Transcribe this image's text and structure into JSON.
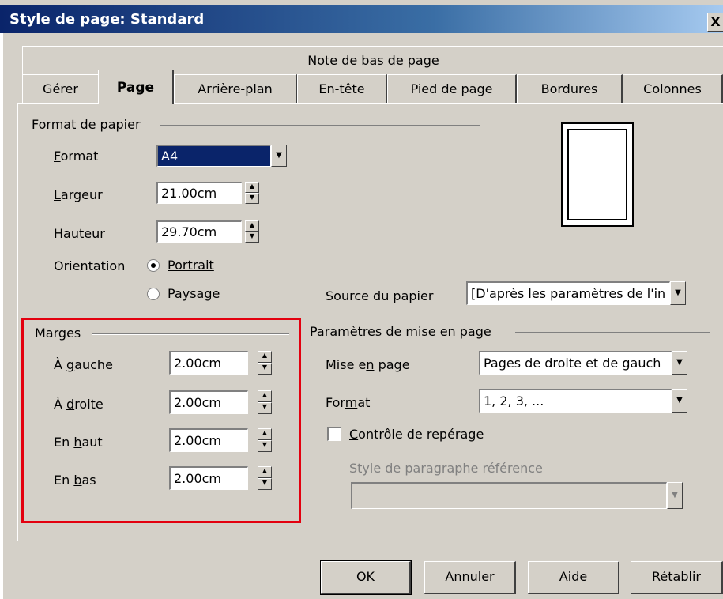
{
  "window": {
    "title": "Style de page: Standard",
    "close_glyph": "X"
  },
  "tabs": {
    "row1": [
      {
        "label": "Note de bas de page"
      }
    ],
    "row2": [
      {
        "label": "Gérer"
      },
      {
        "label": "Page",
        "active": true
      },
      {
        "label": "Arrière-plan"
      },
      {
        "label": "En-tête"
      },
      {
        "label": "Pied de page"
      },
      {
        "label": "Bordures"
      },
      {
        "label": "Colonnes"
      }
    ]
  },
  "paper": {
    "group_label": "Format de papier",
    "format_label": "Format",
    "format_value": "A4",
    "width_label": "Largeur",
    "width_value": "21.00cm",
    "height_label": "Hauteur",
    "height_value": "29.70cm",
    "orientation_label": "Orientation",
    "portrait_label": "Portrait",
    "landscape_label": "Paysage",
    "orientation_selected": "Portrait",
    "source_label": "Source du papier",
    "source_value": "[D'après les paramètres de l'in"
  },
  "margins": {
    "group_label": "Marges",
    "left_label": "À gauche",
    "left_value": "2.00cm",
    "right_label": "À droite",
    "right_value": "2.00cm",
    "top_label": "En haut",
    "top_value": "2.00cm",
    "bottom_label": "En bas",
    "bottom_value": "2.00cm"
  },
  "layout": {
    "group_label": "Paramètres de mise en page",
    "layout_label": "Mise en page",
    "layout_value": "Pages de droite et de gauch",
    "format_label": "Format",
    "format_value": "1, 2, 3, ...",
    "register_label": "Contrôle de repérage",
    "register_checked": false,
    "ref_style_label": "Style de paragraphe référence",
    "ref_style_value": ""
  },
  "buttons": {
    "ok": "OK",
    "cancel": "Annuler",
    "help": "Aide",
    "reset": "Rétablir"
  },
  "colors": {
    "highlight": "#e3000f",
    "titlebar": "#0a246a",
    "face": "#d4d0c8"
  }
}
